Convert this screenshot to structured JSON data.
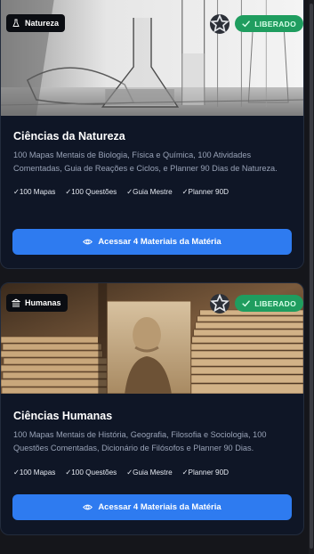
{
  "cards": [
    {
      "tag": "Natureza",
      "status": "LIBERADO",
      "title": "Ciências da Natureza",
      "description": "100 Mapas Mentais de Biologia, Física e Química, 100 Atividades Comentadas, Guia de Reações e Ciclos, e Planner 90 Dias de Natureza.",
      "chips": [
        "✓100 Mapas",
        "✓100 Questões",
        "✓Guia Mestre",
        "✓Planner 90D"
      ],
      "cta": "Acessar 4 Materiais da Matéria"
    },
    {
      "tag": "Humanas",
      "status": "LIBERADO",
      "title": "Ciências Humanas",
      "description": "100 Mapas Mentais de História, Geografia, Filosofia e Sociologia, 100 Questões Comentadas, Dicionário de Filósofos e Planner 90 Dias.",
      "chips": [
        "✓100 Mapas",
        "✓100 Questões",
        "✓Guia Mestre",
        "✓Planner 90D"
      ],
      "cta": "Acessar 4 Materiais da Matéria"
    }
  ],
  "icons": {
    "natureza_tag": "flask-icon",
    "humanas_tag": "landmark-icon",
    "favorite": "star-icon",
    "status": "check-icon",
    "cta": "eye-icon"
  },
  "colors": {
    "accent": "#2e7bf0",
    "status": "#1f9d5f",
    "card_bg": "#0f1626",
    "page_bg": "#15161b"
  }
}
